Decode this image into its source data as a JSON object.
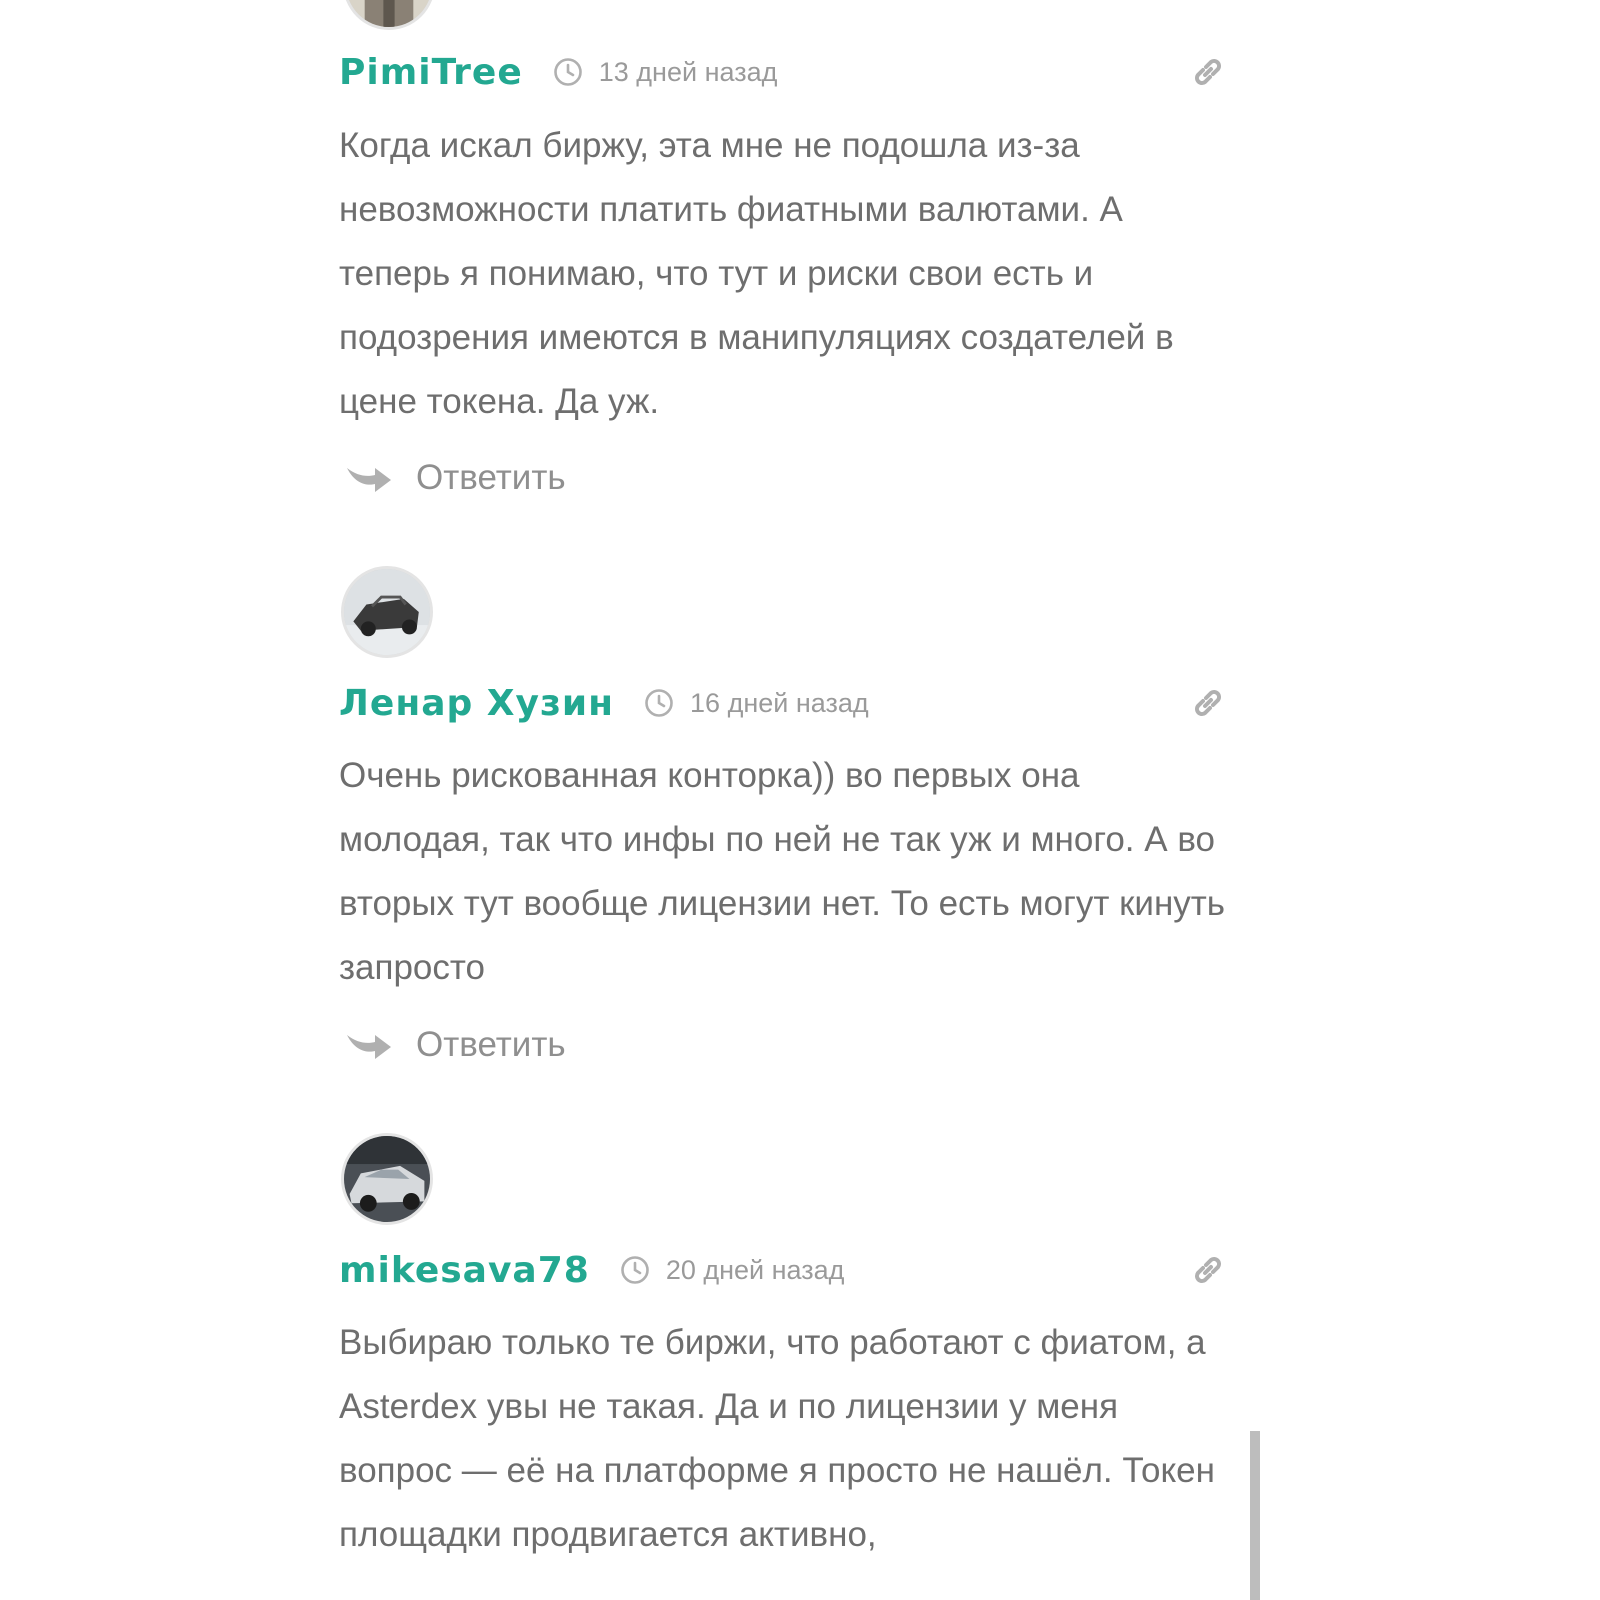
{
  "icons": {
    "clock": "clock-icon",
    "link": "link-icon",
    "reply": "reply-arrow-icon"
  },
  "colors": {
    "author": "#23a891",
    "body_text": "#6e6e6e",
    "meta_text": "#9a9a9a",
    "icon": "#b0b0b0"
  },
  "comments": [
    {
      "author": "PimiTree",
      "time": "13 дней назад",
      "text": "Когда искал биржу, эта мне не подошла из-за невозможности платить фиатными валютами. А теперь я понимаю, что тут и риски свои есть и подозрения имеются в манипуляциях создателей в цене токена. Да уж.",
      "reply_label": "Ответить"
    },
    {
      "author": "Ленар Хузин",
      "time": "16 дней назад",
      "text": "Очень рискованная конторка)) во первых она молодая, так что инфы по ней не так уж и много. А во вторых тут вообще лицензии нет. То есть могут кинуть запросто",
      "reply_label": "Ответить"
    },
    {
      "author": "mikesava78",
      "time": "20 дней назад",
      "text": "Выбираю только те биржи, что работают с фиатом, а Asterdex увы не такая. Да и по лицензии у меня вопрос — её на платформе я просто не нашёл. Токен площадки продвигается активно,"
    }
  ]
}
